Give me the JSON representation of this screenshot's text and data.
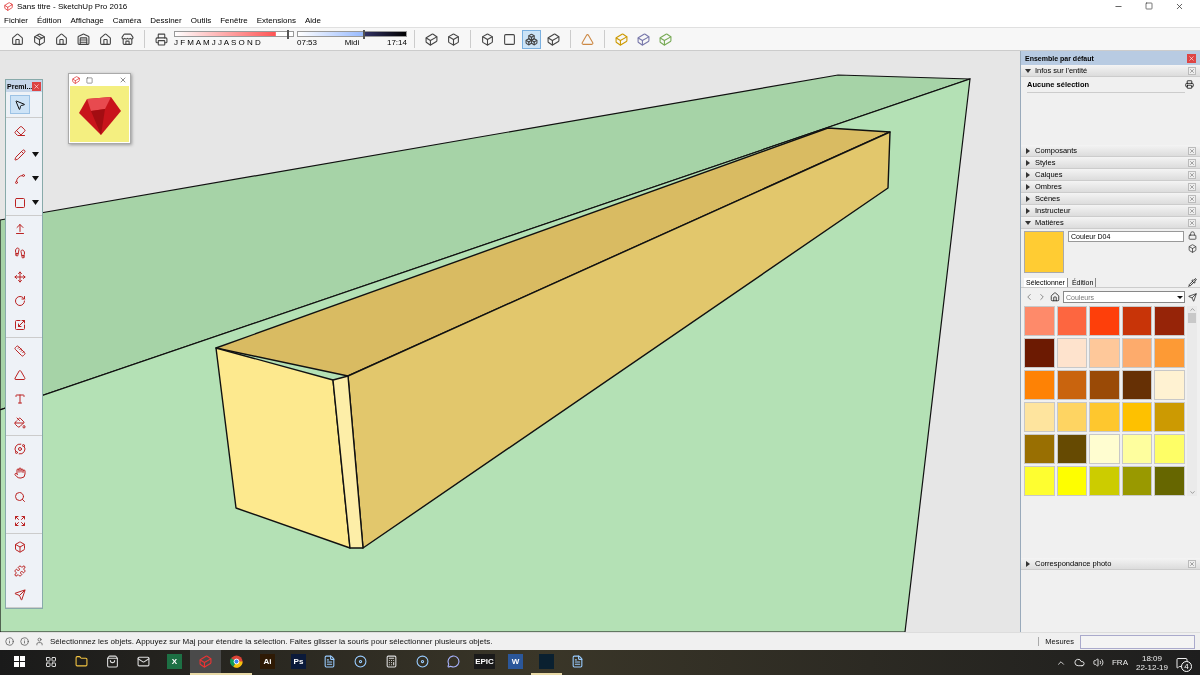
{
  "window": {
    "title": "Sans titre - SketchUp Pro 2016"
  },
  "menu": [
    "Fichier",
    "Édition",
    "Affichage",
    "Caméra",
    "Dessiner",
    "Outils",
    "Fenêtre",
    "Extensions",
    "Aide"
  ],
  "toolbar": {
    "months": "J F M A M J J A S O N D",
    "month_slider": {
      "level": 0.95
    },
    "time_start": "07:53",
    "time_mid": "Midi",
    "time_end": "17:14",
    "time_slider": {
      "level": 0.6
    },
    "face_styles": [
      {
        "selected": false
      },
      {
        "selected": false
      },
      {
        "selected": false
      },
      {
        "selected": false
      },
      {
        "selected": true
      },
      {
        "selected": false
      }
    ]
  },
  "tools_window": {
    "title": "Premi...",
    "groups": [
      [
        {
          "selected": true,
          "has_menu": false
        }
      ],
      [
        {
          "selected": false,
          "has_menu": false
        },
        {
          "selected": false,
          "has_menu": true
        },
        {
          "selected": false,
          "has_menu": true
        },
        {
          "selected": false,
          "has_menu": true
        }
      ],
      [
        {
          "selected": false,
          "has_menu": false
        },
        {
          "selected": false,
          "has_menu": false
        },
        {
          "selected": false,
          "has_menu": false
        },
        {
          "selected": false,
          "has_menu": false
        },
        {
          "selected": false,
          "has_menu": false
        }
      ],
      [
        {
          "selected": false,
          "has_menu": false
        },
        {
          "selected": false,
          "has_menu": false
        },
        {
          "selected": false,
          "has_menu": false
        },
        {
          "selected": false,
          "has_menu": false
        }
      ],
      [
        {
          "selected": false,
          "has_menu": false
        },
        {
          "selected": false,
          "has_menu": false
        },
        {
          "selected": false,
          "has_menu": false
        },
        {
          "selected": false,
          "has_menu": false
        }
      ],
      [
        {
          "selected": false,
          "has_menu": false
        },
        {
          "selected": false,
          "has_menu": false
        },
        {
          "selected": false,
          "has_menu": false
        }
      ]
    ]
  },
  "tray": {
    "title": "Ensemble par défaut",
    "entity_info": {
      "title": "Infos sur l'entité",
      "expanded": true,
      "text": "Aucune sélection"
    },
    "collapsed": [
      {
        "title": "Composants",
        "expanded": false
      },
      {
        "title": "Styles",
        "expanded": false
      },
      {
        "title": "Calques",
        "expanded": false
      },
      {
        "title": "Ombres",
        "expanded": false
      },
      {
        "title": "Scènes",
        "expanded": false
      },
      {
        "title": "Instructeur",
        "expanded": false
      }
    ],
    "materials": {
      "title": "Matières",
      "expanded": true,
      "color": "#ffcc33",
      "name": "Couleur D04",
      "tabs": [
        {
          "label": "Sélectionner",
          "selected": true
        },
        {
          "label": "Édition",
          "selected": false
        }
      ],
      "library": "Couleurs",
      "swatches": [
        {
          "color": "#fe8a6a"
        },
        {
          "color": "#fd6640"
        },
        {
          "color": "#fe3f0a"
        },
        {
          "color": "#c83408"
        },
        {
          "color": "#962408"
        },
        {
          "color": "#6c1a02"
        },
        {
          "color": "#fee3cd"
        },
        {
          "color": "#fec89a"
        },
        {
          "color": "#fdab6c"
        },
        {
          "color": "#fd9a35"
        },
        {
          "color": "#fe8205"
        },
        {
          "color": "#c9640e"
        },
        {
          "color": "#9a4a06"
        },
        {
          "color": "#663005"
        },
        {
          "color": "#fff2d2"
        },
        {
          "color": "#fee49e"
        },
        {
          "color": "#fed462"
        },
        {
          "color": "#fec72e"
        },
        {
          "color": "#fec100"
        },
        {
          "color": "#cc9a02"
        },
        {
          "color": "#996f02"
        },
        {
          "color": "#664a02"
        },
        {
          "color": "#fffdd0"
        },
        {
          "color": "#fefe9e"
        },
        {
          "color": "#fefe66"
        },
        {
          "color": "#fefe30"
        },
        {
          "color": "#fefe00"
        },
        {
          "color": "#cccc00"
        },
        {
          "color": "#999900"
        },
        {
          "color": "#666600"
        }
      ]
    },
    "photo": {
      "title": "Correspondance photo",
      "expanded": false
    }
  },
  "status_bar": {
    "text": "Sélectionnez les objets. Appuyez sur Maj pour étendre la sélection. Faites glisser la souris pour sélectionner plusieurs objets.",
    "measure_label": "Mesures"
  },
  "taskbar": {
    "apps": [
      {
        "kind": "taskview",
        "running": false,
        "selected": false
      },
      {
        "kind": "folder",
        "running": false,
        "selected": false
      },
      {
        "kind": "store",
        "running": false,
        "selected": false
      },
      {
        "kind": "mail",
        "running": false,
        "selected": false
      },
      {
        "kind": "tile",
        "text": "X",
        "color": "#1d7044",
        "running": false,
        "selected": false
      },
      {
        "kind": "sketchup",
        "running": true,
        "selected": true
      },
      {
        "kind": "chrome",
        "running": true,
        "selected": false
      },
      {
        "kind": "tile",
        "text": "Ai",
        "color": "#2e1a05",
        "running": false,
        "selected": false
      },
      {
        "kind": "tile",
        "text": "Ps",
        "color": "#0b1a3a",
        "running": false,
        "selected": false
      },
      {
        "kind": "doc",
        "running": false,
        "selected": false
      },
      {
        "kind": "disc",
        "running": false,
        "selected": false
      },
      {
        "kind": "calc",
        "running": false,
        "selected": false
      },
      {
        "kind": "disc",
        "running": false,
        "selected": false
      },
      {
        "kind": "chat",
        "running": false,
        "selected": false
      },
      {
        "kind": "tile",
        "text": "EPIC",
        "color": "#1a1a1a",
        "running": false,
        "selected": false
      },
      {
        "kind": "tile",
        "text": "W",
        "color": "#2b579a",
        "running": false,
        "selected": false
      },
      {
        "kind": "tile",
        "color": "#0a2030",
        "running": true,
        "selected": false
      },
      {
        "kind": "doc",
        "running": false,
        "selected": false
      }
    ],
    "language": "FRA",
    "time": "18:09",
    "date": "22-12-19",
    "notifications": "4"
  }
}
